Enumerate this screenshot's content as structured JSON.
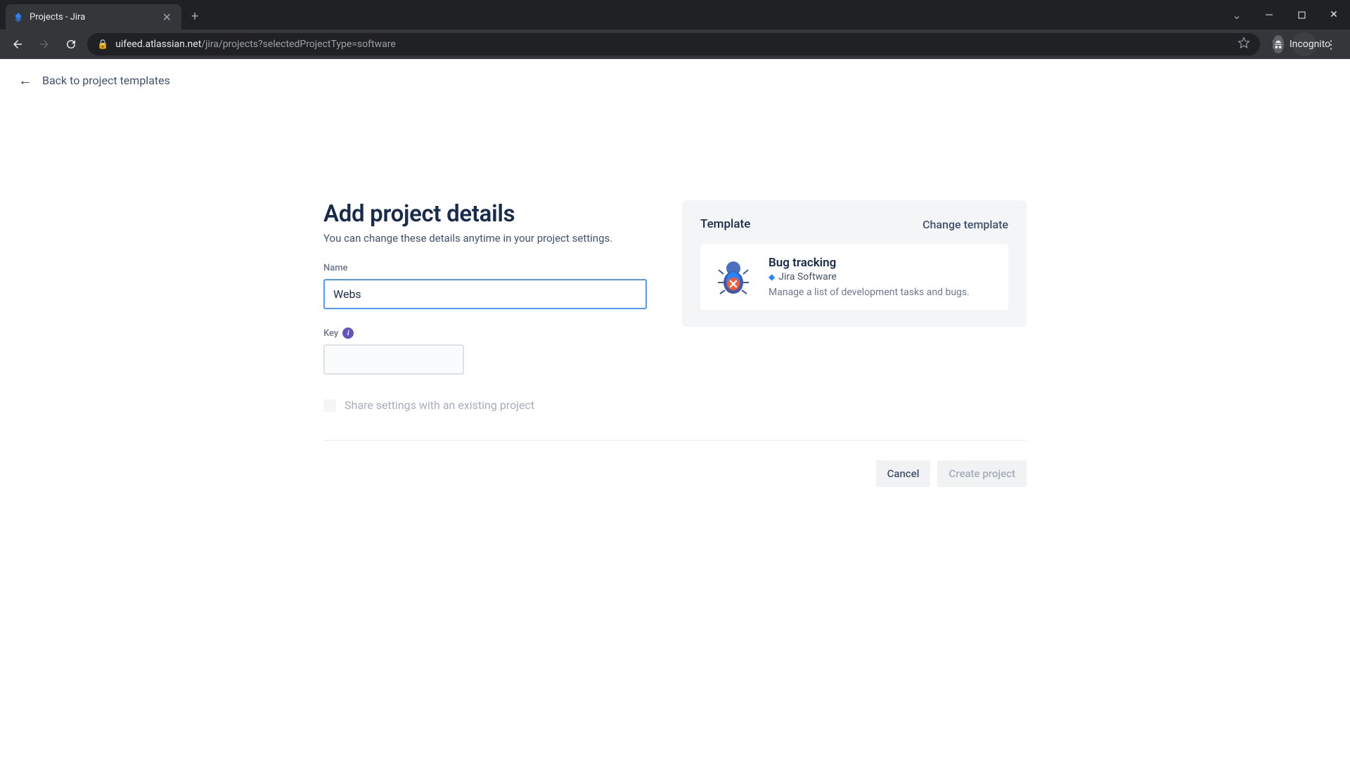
{
  "browser": {
    "tab_title": "Projects - Jira",
    "url_host": "uifeed.atlassian.net",
    "url_path": "/jira/projects?selectedProjectType=software",
    "incognito_label": "Incognito"
  },
  "page": {
    "back_link": "Back to project templates",
    "heading": "Add project details",
    "subheading": "You can change these details anytime in your project settings.",
    "name_label": "Name",
    "name_value": "Webs",
    "key_label": "Key",
    "key_value": "",
    "share_label": "Share settings with an existing project"
  },
  "template": {
    "section_label": "Template",
    "change_label": "Change template",
    "name": "Bug tracking",
    "product": "Jira Software",
    "description": "Manage a list of development tasks and bugs."
  },
  "actions": {
    "cancel": "Cancel",
    "create": "Create project"
  }
}
